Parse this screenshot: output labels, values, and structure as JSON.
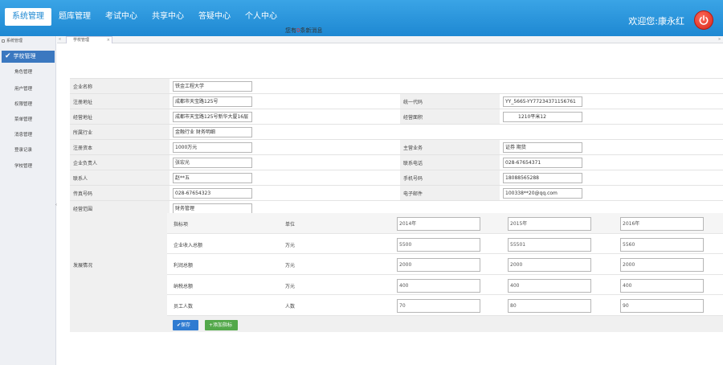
{
  "nav": {
    "items": [
      "系统管理",
      "题库管理",
      "考试中心",
      "共享中心",
      "答疑中心",
      "个人中心"
    ],
    "active_index": 0
  },
  "header": {
    "welcome": "欢迎您:康永红",
    "notice_prefix": "您有",
    "notice_count": "0",
    "notice_suffix": "条新消息"
  },
  "sidebar": {
    "title": "系统管理",
    "active_item": "学校管理",
    "items": [
      "角色管理",
      "用户管理",
      "权限管理",
      "菜单管理",
      "消息管理",
      "登录记录",
      "学校管理"
    ]
  },
  "tabs": [
    {
      "label": "学校管理"
    }
  ],
  "form": {
    "company_name_label": "企业名称",
    "company_name": "铁金工程大学",
    "reg_addr_label": "注册地址",
    "reg_addr": "成都市天宝路125号",
    "credit_code_label": "统一代码",
    "credit_code": "YY_5665-YY77234371156761",
    "office_addr_label": "经营地址",
    "office_addr": "成都市天宝路125号新华大厦16层",
    "office_area_label": "经营面积",
    "office_area": "1210平米12",
    "industry_label": "所属行业",
    "industry": "金融行业 财务明细",
    "capital_label": "注册资本",
    "capital": "1000万元",
    "business_label": "主营业务",
    "business": "证券 期货",
    "legal_label": "企业负责人",
    "legal": "张宏光",
    "contact_phone_label": "联系电话",
    "contact_phone": "028-67654371",
    "contact_label": "联系人",
    "contact": "赵**五",
    "mobile_label": "手机号码",
    "mobile": "18088565288",
    "fax_label": "传真号码",
    "fax": "028-67654323",
    "email_label": "电子邮件",
    "email": "100338**20@qq.com",
    "scope_label": "经营范围",
    "scope": "财务管理"
  },
  "development": {
    "label": "发展情况",
    "header": {
      "indicator": "指标项",
      "unit": "单位",
      "years": [
        "2014年",
        "2015年",
        "2016年"
      ]
    },
    "rows": [
      {
        "indicator": "企业收入总额",
        "unit": "万元",
        "values": [
          "5500",
          "55501",
          "5560"
        ]
      },
      {
        "indicator": "利润总额",
        "unit": "万元",
        "values": [
          "2000",
          "2000",
          "2000"
        ]
      },
      {
        "indicator": "纳税总额",
        "unit": "万元",
        "values": [
          "400",
          "400",
          "400"
        ]
      },
      {
        "indicator": "员工人数",
        "unit": "人数",
        "values": [
          "70",
          "80",
          "90"
        ]
      }
    ]
  },
  "actions": {
    "save": "保存",
    "add": "添加指标"
  },
  "colors": {
    "topbar": "#1e88d2",
    "sidebar_active": "#3b78c0",
    "save": "#2f7bd1",
    "add": "#53a84a",
    "power": "#d6261a"
  }
}
